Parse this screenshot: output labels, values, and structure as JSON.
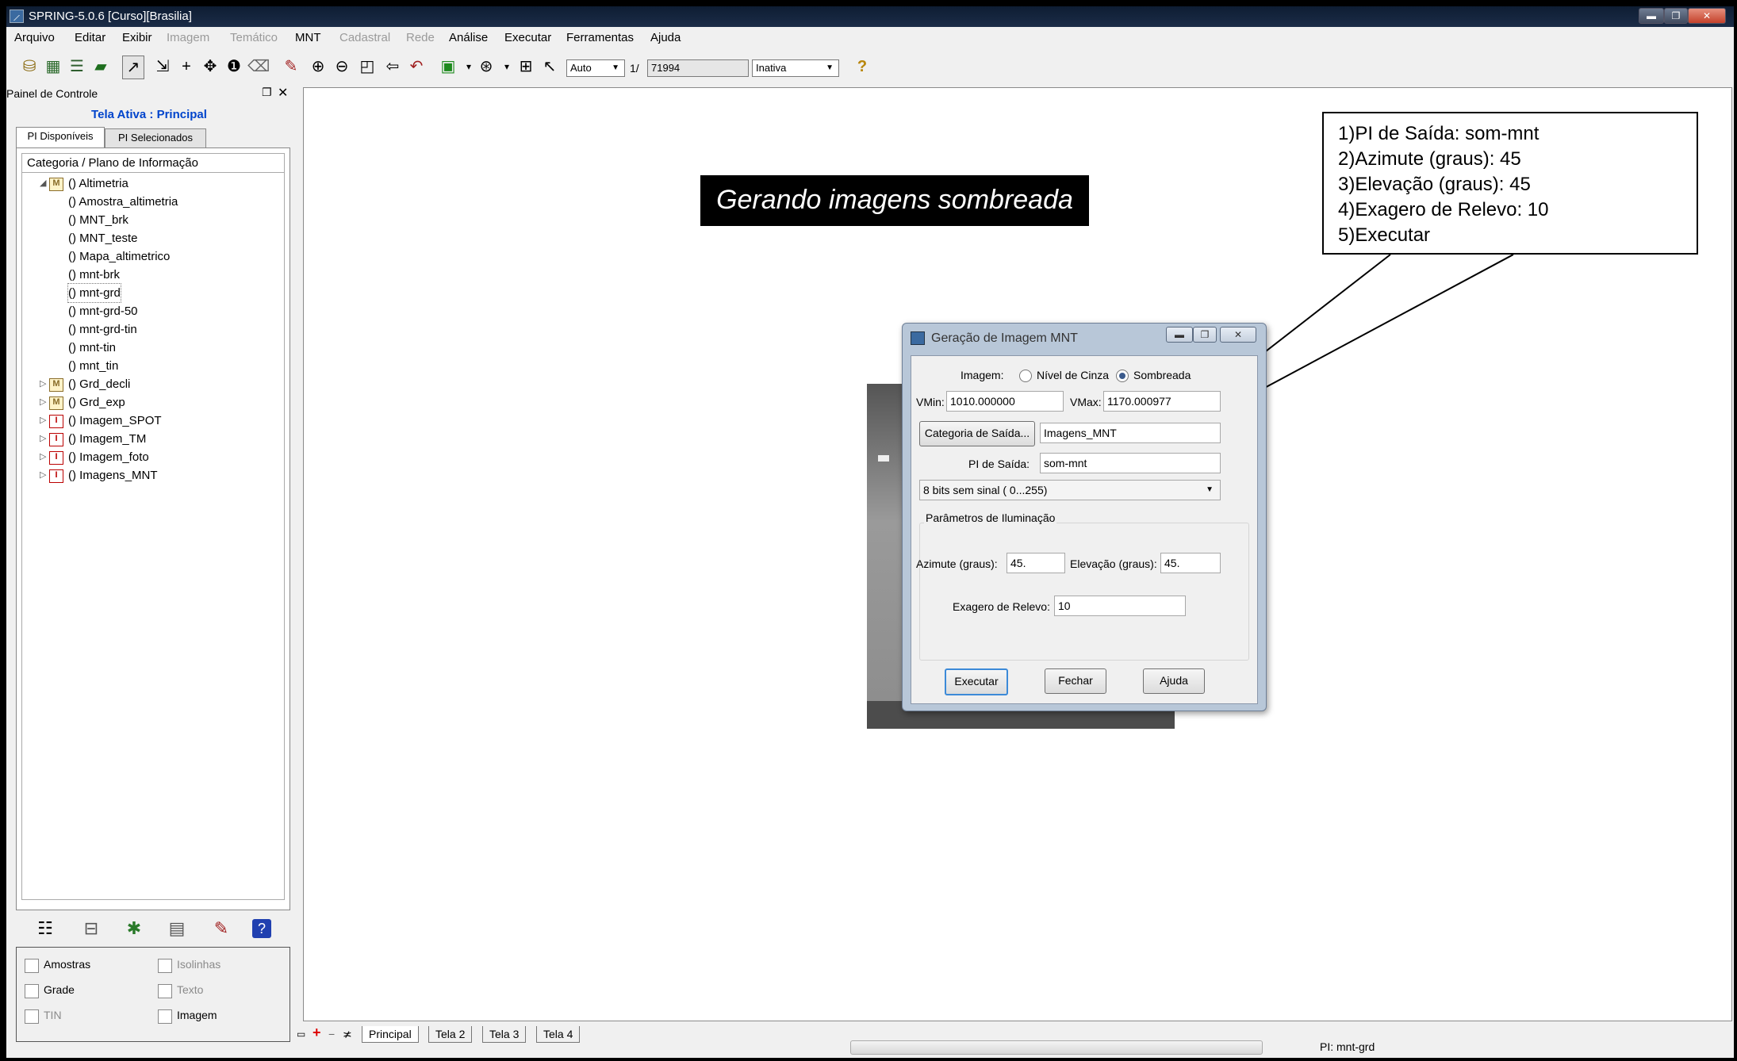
{
  "window": {
    "title": "SPRING-5.0.6 [Curso][Brasilia]",
    "controls": {
      "minimize": "▬",
      "maximize": "❐",
      "close": "✕"
    }
  },
  "menubar": {
    "items": [
      {
        "label": "Arquivo",
        "enabled": true
      },
      {
        "label": "Editar",
        "enabled": true
      },
      {
        "label": "Exibir",
        "enabled": true
      },
      {
        "label": "Imagem",
        "enabled": false
      },
      {
        "label": "Temático",
        "enabled": false
      },
      {
        "label": "MNT",
        "enabled": true
      },
      {
        "label": "Cadastral",
        "enabled": false
      },
      {
        "label": "Rede",
        "enabled": false
      },
      {
        "label": "Análise",
        "enabled": true
      },
      {
        "label": "Executar",
        "enabled": true
      },
      {
        "label": "Ferramentas",
        "enabled": true
      },
      {
        "label": "Ajuda",
        "enabled": true
      }
    ]
  },
  "toolbar": {
    "zoom_mode": "Auto",
    "scale_prefix": "1/",
    "scale_value": "71994",
    "state": "Inativa",
    "help_glyph": "?"
  },
  "control_panel": {
    "title": "Painel de Controle",
    "active_screen": "Tela Ativa : Principal",
    "tabs": [
      "PI Disponíveis",
      "PI Selecionados"
    ],
    "tree_header": "Categoria / Plano de Informação",
    "tree": [
      {
        "label": "() Altimetria",
        "badge": "M",
        "expanded": true,
        "level": 0
      },
      {
        "label": "() Amostra_altimetria",
        "level": 1
      },
      {
        "label": "() MNT_brk",
        "level": 1
      },
      {
        "label": "() MNT_teste",
        "level": 1
      },
      {
        "label": "() Mapa_altimetrico",
        "level": 1
      },
      {
        "label": "() mnt-brk",
        "level": 1
      },
      {
        "label": "() mnt-grd",
        "level": 1,
        "selected": true
      },
      {
        "label": "() mnt-grd-50",
        "level": 1
      },
      {
        "label": "() mnt-grd-tin",
        "level": 1
      },
      {
        "label": "() mnt-tin",
        "level": 1
      },
      {
        "label": "() mnt_tin",
        "level": 1
      },
      {
        "label": "() Grd_decli",
        "badge": "M",
        "expanded": false,
        "level": 0
      },
      {
        "label": "() Grd_exp",
        "badge": "M",
        "expanded": false,
        "level": 0
      },
      {
        "label": "() Imagem_SPOT",
        "badge": "I",
        "expanded": false,
        "level": 0
      },
      {
        "label": "() Imagem_TM",
        "badge": "I",
        "expanded": false,
        "level": 0
      },
      {
        "label": "() Imagem_foto",
        "badge": "I",
        "expanded": false,
        "level": 0
      },
      {
        "label": "() Imagens_MNT",
        "badge": "I",
        "expanded": false,
        "level": 0
      }
    ],
    "checkboxes": [
      {
        "label": "Amostras",
        "enabled": true
      },
      {
        "label": "Isolinhas",
        "enabled": false
      },
      {
        "label": "Grade",
        "enabled": true
      },
      {
        "label": "Texto",
        "enabled": false
      },
      {
        "label": "TIN",
        "enabled": false
      },
      {
        "label": "Imagem",
        "enabled": true
      }
    ]
  },
  "canvas": {
    "banner": "Gerando imagens sombreada",
    "callout_lines": [
      "1)PI de Saída: som-mnt",
      "2)Azimute (graus): 45",
      "3)Elevação (graus): 45",
      "4)Exagero de Relevo: 10",
      "5)Executar"
    ]
  },
  "dialog": {
    "title": "Geração de Imagem MNT",
    "imagem_label": "Imagem:",
    "option_cinza": "Nível de Cinza",
    "option_sombreada": "Sombreada",
    "selected_option": "Sombreada",
    "vmin_label": "VMin:",
    "vmin_value": "1010.000000",
    "vmax_label": "VMax:",
    "vmax_value": "1170.000977",
    "categoria_button": "Categoria de Saída...",
    "categoria_value": "Imagens_MNT",
    "pi_label": "PI de Saída:",
    "pi_value": "som-mnt",
    "bits_option": "8 bits sem sinal ( 0...255)",
    "group_label": "Parâmetros de Iluminação",
    "azimute_label": "Azimute (graus):",
    "azimute_value": "45.",
    "elevacao_label": "Elevação (graus):",
    "elevacao_value": "45.",
    "exagero_label": "Exagero de Relevo:",
    "exagero_value": "10",
    "buttons": {
      "executar": "Executar",
      "fechar": "Fechar",
      "ajuda": "Ajuda"
    }
  },
  "bottom_tabs": [
    "Principal",
    "Tela 2",
    "Tela 3",
    "Tela 4"
  ],
  "status": {
    "pi": "PI: mnt-grd"
  }
}
